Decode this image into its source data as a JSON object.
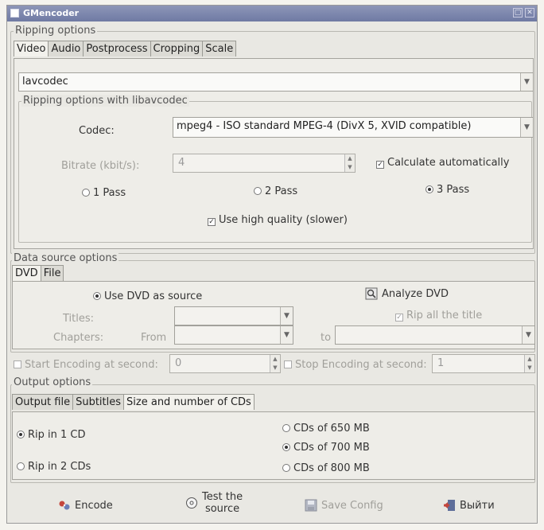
{
  "window": {
    "title": "GMencoder"
  },
  "ripping": {
    "legend": "Ripping options",
    "tabs": [
      "Video",
      "Audio",
      "Postprocess",
      "Cropping",
      "Scale"
    ],
    "codec_family": "lavcodec",
    "inner_legend": "Ripping options with libavcodec",
    "codec_label": "Codec:",
    "codec_value": "mpeg4 - ISO standard MPEG-4 (DivX 5, XVID compatible)",
    "bitrate_label": "Bitrate (kbit/s):",
    "bitrate_value": "4",
    "calc_auto": "Calculate automatically",
    "pass1": "1 Pass",
    "pass2": "2 Pass",
    "pass3": "3 Pass",
    "hq": "Use high quality (slower)"
  },
  "datasource": {
    "legend": "Data source options",
    "tabs": [
      "DVD",
      "File"
    ],
    "use_dvd": "Use DVD as source",
    "analyze": "Analyze DVD",
    "titles_label": "Titles:",
    "rip_all": "Rip all the title",
    "chapters_label": "Chapters:",
    "from_label": "From",
    "to_label": "to",
    "start_enc": "Start Encoding at second:",
    "start_val": "0",
    "stop_enc": "Stop Encoding at second:",
    "stop_val": "1"
  },
  "output": {
    "legend": "Output options",
    "tabs": [
      "Output file",
      "Subtitles",
      "Size and number of CDs"
    ],
    "rip1": "Rip in 1 CD",
    "rip2": "Rip in 2 CDs",
    "cd650": "CDs of 650 MB",
    "cd700": "CDs of 700 MB",
    "cd800": "CDs of 800 MB"
  },
  "actions": {
    "encode": "Encode",
    "test_line1": "Test the",
    "test_line2": "source",
    "save": "Save Config",
    "exit": "Выйти"
  },
  "colors": {
    "titlebar": "#7f89b0",
    "window": "#e9e8e3"
  }
}
